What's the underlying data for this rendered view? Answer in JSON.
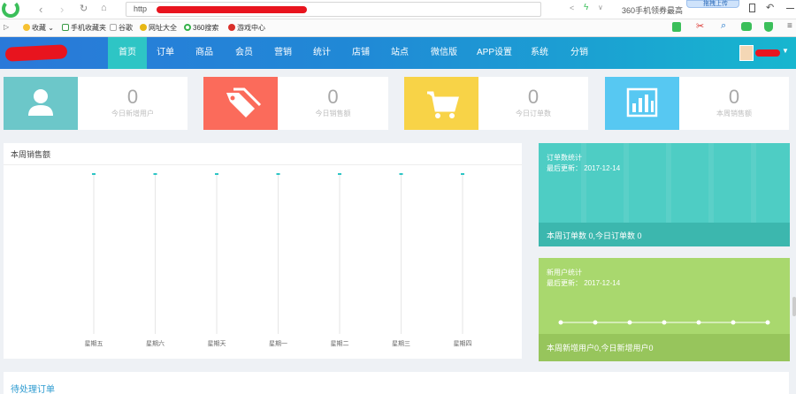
{
  "browser": {
    "address_text": "http",
    "right_text": "360手机领券最高",
    "popup_label": "拖拽上传"
  },
  "bookmarks": [
    {
      "label": "收藏",
      "icon": "star-icon"
    },
    {
      "label": "手机收藏夹",
      "icon": "phone-icon"
    },
    {
      "label": "谷歌",
      "icon": "page-icon"
    },
    {
      "label": "网址大全",
      "icon": "globe-icon"
    },
    {
      "label": "360搜索",
      "icon": "search-icon"
    },
    {
      "label": "游戏中心",
      "icon": "game-icon"
    }
  ],
  "nav": {
    "items": [
      "首页",
      "订单",
      "商品",
      "会员",
      "营销",
      "统计",
      "店铺",
      "站点",
      "微信版",
      "APP设置",
      "系统",
      "分销"
    ],
    "active_index": 0
  },
  "cards": [
    {
      "value": "0",
      "label": "今日新增用户",
      "color": "#6cc7c9",
      "icon": "user-icon"
    },
    {
      "value": "0",
      "label": "今日销售额",
      "color": "#fb6b5b",
      "icon": "tag-icon"
    },
    {
      "value": "0",
      "label": "今日订单数",
      "color": "#f8d347",
      "icon": "cart-icon"
    },
    {
      "value": "0",
      "label": "本周销售额",
      "color": "#57c8f2",
      "icon": "bar-chart-icon"
    }
  ],
  "sales_panel": {
    "title": "本周销售额"
  },
  "chart_data": {
    "type": "line",
    "categories": [
      "星期五",
      "星期六",
      "星期天",
      "星期一",
      "星期二",
      "星期三",
      "星期四"
    ],
    "values": [
      0,
      0,
      0,
      0,
      0,
      0,
      0
    ],
    "title": "本周销售额",
    "grid": true
  },
  "order_stats": {
    "title": "订单数统计",
    "updated": "最后更新： 2017-12-14",
    "footer": "本周订单数 0,今日订单数 0",
    "color": "#4ecdc4",
    "footer_color": "#3cb7ae"
  },
  "user_stats": {
    "title": "新用户统计",
    "updated": "最后更新： 2017-12-14",
    "footer": "本周新增用户0,今日新增用户0",
    "color": "#a9d86e",
    "footer_color": "#97c55c",
    "chart_data": {
      "type": "line",
      "values": [
        0,
        0,
        0,
        0,
        0,
        0,
        0
      ]
    }
  },
  "pending": {
    "title": "待处理订单"
  }
}
